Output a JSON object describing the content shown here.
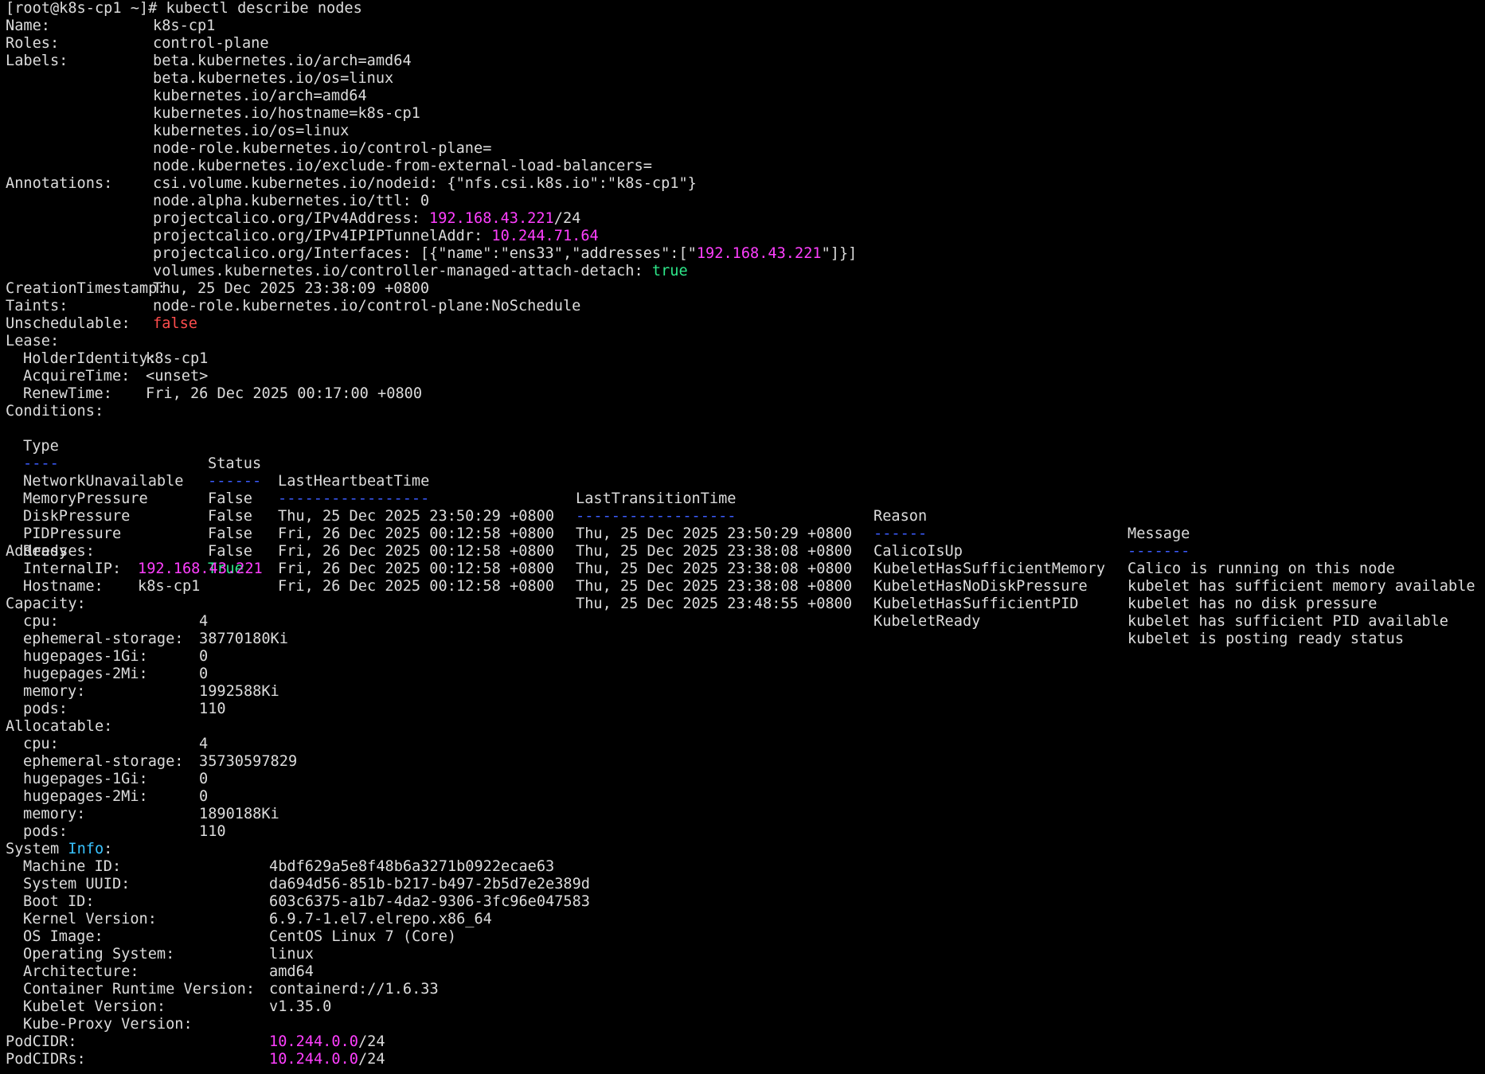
{
  "terminal": {
    "prompt": "[root@k8s-cp1 ~]#",
    "command": "kubectl describe nodes",
    "name_key": "Name:",
    "name_val": "k8s-cp1",
    "roles_key": "Roles:",
    "roles_val": "control-plane",
    "labels_key": "Labels:",
    "labels": [
      "beta.kubernetes.io/arch=amd64",
      "beta.kubernetes.io/os=linux",
      "kubernetes.io/arch=amd64",
      "kubernetes.io/hostname=k8s-cp1",
      "kubernetes.io/os=linux",
      "node-role.kubernetes.io/control-plane=",
      "node.kubernetes.io/exclude-from-external-load-balancers="
    ],
    "annotations_key": "Annotations:",
    "annotations": {
      "a1": "csi.volume.kubernetes.io/nodeid: {\"nfs.csi.k8s.io\":\"k8s-cp1\"}",
      "a2": "node.alpha.kubernetes.io/ttl: 0",
      "a3_pre": "projectcalico.org/IPv4Address: ",
      "a3_ip": "192.168.43.221",
      "a3_post": "/24",
      "a4_pre": "projectcalico.org/IPv4IPIPTunnelAddr: ",
      "a4_ip": "10.244.71.64",
      "a5_pre": "projectcalico.org/Interfaces: [{\"name\":\"ens33\",\"addresses\":[\"",
      "a5_ip": "192.168.43.221",
      "a5_post": "\"]}]",
      "a6_pre": "volumes.kubernetes.io/controller-managed-attach-detach: ",
      "a6_val": "true"
    },
    "creation_key": "CreationTimestamp:",
    "creation_val": "Thu, 25 Dec 2025 23:38:09 +0800",
    "taints_key": "Taints:",
    "taints_val": "node-role.kubernetes.io/control-plane:NoSchedule",
    "unsched_key": "Unschedulable:",
    "unsched_val": "false",
    "lease_key": "Lease:",
    "holder_key": "HolderIdentity:",
    "holder_val": "k8s-cp1",
    "acquire_key": "AcquireTime:",
    "acquire_val": "<unset>",
    "renew_key": "RenewTime:",
    "renew_val": "Fri, 26 Dec 2025 00:17:00 +0800",
    "conditions_key": "Conditions:",
    "cond_headers": [
      "Type",
      "Status",
      "LastHeartbeatTime",
      "LastTransitionTime",
      "Reason",
      "Message"
    ],
    "cond_dashes": [
      "----",
      "------",
      "-----------------",
      "------------------",
      "------",
      "-------"
    ],
    "cond_rows": [
      [
        "NetworkUnavailable",
        "False",
        "Thu, 25 Dec 2025 23:50:29 +0800",
        "Thu, 25 Dec 2025 23:50:29 +0800",
        "CalicoIsUp",
        "Calico is running on this node"
      ],
      [
        "MemoryPressure",
        "False",
        "Fri, 26 Dec 2025 00:12:58 +0800",
        "Thu, 25 Dec 2025 23:38:08 +0800",
        "KubeletHasSufficientMemory",
        "kubelet has sufficient memory available"
      ],
      [
        "DiskPressure",
        "False",
        "Fri, 26 Dec 2025 00:12:58 +0800",
        "Thu, 25 Dec 2025 23:38:08 +0800",
        "KubeletHasNoDiskPressure",
        "kubelet has no disk pressure"
      ],
      [
        "PIDPressure",
        "False",
        "Fri, 26 Dec 2025 00:12:58 +0800",
        "Thu, 25 Dec 2025 23:38:08 +0800",
        "KubeletHasSufficientPID",
        "kubelet has sufficient PID available"
      ],
      [
        "Ready",
        "True",
        "Fri, 26 Dec 2025 00:12:58 +0800",
        "Thu, 25 Dec 2025 23:48:55 +0800",
        "KubeletReady",
        "kubelet is posting ready status"
      ]
    ],
    "addresses_key": "Addresses:",
    "internalip_key": "InternalIP:",
    "internalip_val": "192.168.43.221",
    "hostname_key": "Hostname:",
    "hostname_val": "k8s-cp1",
    "capacity_key": "Capacity:",
    "capacity": [
      [
        "cpu:",
        "4"
      ],
      [
        "ephemeral-storage:",
        "38770180Ki"
      ],
      [
        "hugepages-1Gi:",
        "0"
      ],
      [
        "hugepages-2Mi:",
        "0"
      ],
      [
        "memory:",
        "1992588Ki"
      ],
      [
        "pods:",
        "110"
      ]
    ],
    "allocatable_key": "Allocatable:",
    "allocatable": [
      [
        "cpu:",
        "4"
      ],
      [
        "ephemeral-storage:",
        "35730597829"
      ],
      [
        "hugepages-1Gi:",
        "0"
      ],
      [
        "hugepages-2Mi:",
        "0"
      ],
      [
        "memory:",
        "1890188Ki"
      ],
      [
        "pods:",
        "110"
      ]
    ],
    "sysinfo_pre": "System ",
    "sysinfo_word": "Info",
    "sysinfo_post": ":",
    "sysinfo": [
      [
        "Machine ID:",
        "4bdf629a5e8f48b6a3271b0922ecae63"
      ],
      [
        "System UUID:",
        "da694d56-851b-b217-b497-2b5d7e2e389d"
      ],
      [
        "Boot ID:",
        "603c6375-a1b7-4da2-9306-3fc96e047583"
      ],
      [
        "Kernel Version:",
        "6.9.7-1.el7.elrepo.x86_64"
      ],
      [
        "OS Image:",
        "CentOS Linux 7 (Core)"
      ],
      [
        "Operating System:",
        "linux"
      ],
      [
        "Architecture:",
        "amd64"
      ],
      [
        "Container Runtime Version:",
        "containerd://1.6.33"
      ],
      [
        "Kubelet Version:",
        "v1.35.0"
      ],
      [
        "Kube-Proxy Version:",
        ""
      ]
    ],
    "podcidr_key": "PodCIDR:",
    "podcidr_ip": "10.244.0.0",
    "podcidr_post": "/24",
    "podcidrs_key": "PodCIDRs:",
    "podcidrs_ip": "10.244.0.0",
    "podcidrs_post": "/24"
  },
  "colors": {
    "background": "#000000",
    "text": "#dcdcdc",
    "ip_magenta": "#ff3fff",
    "true_green": "#2ee88a",
    "false_red": "#ff4d4d",
    "info_cyan": "#39c3ff",
    "dash_blue": "#3b5cff"
  }
}
